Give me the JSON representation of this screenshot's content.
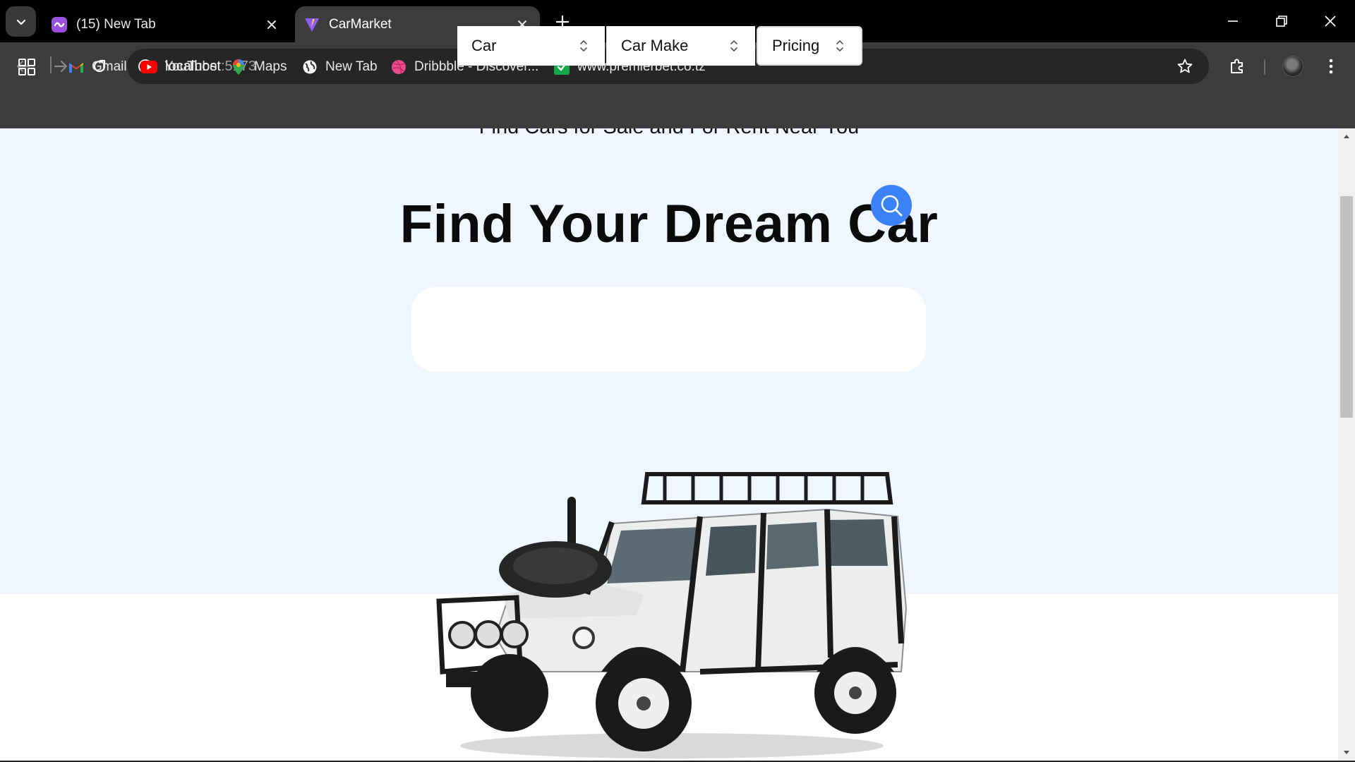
{
  "browser": {
    "tabs": [
      {
        "title": "(15) New Tab",
        "active": false,
        "favicon": "new-tab-favicon-icon"
      },
      {
        "title": "CarMarket",
        "active": true,
        "favicon": "vite-favicon-icon"
      }
    ],
    "url_host": "localhost",
    "url_port": ":5173",
    "bookmarks": [
      {
        "label": "Gmail",
        "icon": "gmail-icon"
      },
      {
        "label": "YouTube",
        "icon": "youtube-icon"
      },
      {
        "label": "Maps",
        "icon": "maps-icon"
      },
      {
        "label": "New Tab",
        "icon": "globe-icon"
      },
      {
        "label": "Dribbble - Discover...",
        "icon": "dribbble-icon"
      },
      {
        "label": "www.premierbet.co.tz",
        "icon": "premierbet-icon"
      }
    ]
  },
  "page": {
    "subtitle": "Find Cars for Sale and For Rent Near You",
    "title": "Find Your Dream Car",
    "search": {
      "car_type": "Car",
      "car_make": "Car Make",
      "pricing": "Pricing"
    },
    "colors": {
      "hero_background": "#eff6ff",
      "search_button": "#3b82f6"
    }
  }
}
